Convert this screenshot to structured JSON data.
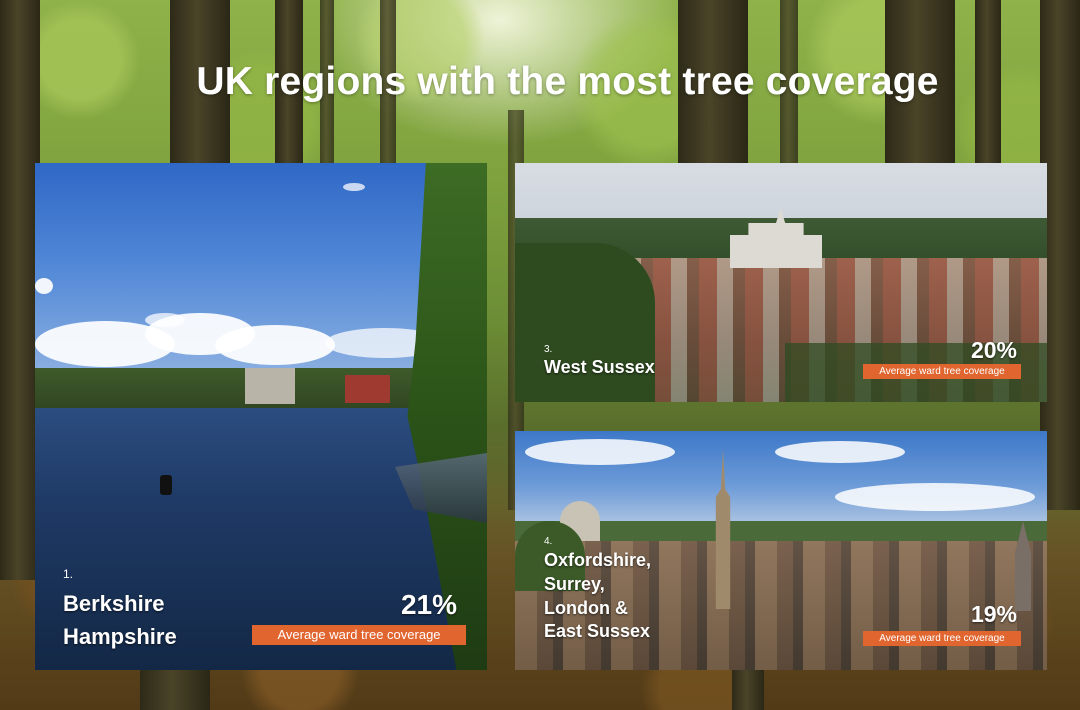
{
  "title": "UK regions with the most tree coverage",
  "regions": [
    {
      "rank": "1.",
      "name_lines": [
        "Berkshire",
        "Hampshire"
      ],
      "percent": "21%",
      "caption": "Average ward tree coverage"
    },
    {
      "rank": "3.",
      "name_lines": [
        "West Sussex"
      ],
      "percent": "20%",
      "caption": "Average ward tree coverage"
    },
    {
      "rank": "4.",
      "name_lines": [
        "Oxfordshire,",
        "Surrey,",
        "London &",
        "East Sussex"
      ],
      "percent": "19%",
      "caption": "Average ward tree coverage"
    }
  ],
  "colors": {
    "caption_bg": "#e0652f",
    "title_text": "#ffffff"
  },
  "images": [
    "river-with-rower-photo",
    "town-with-cathedral-photo",
    "oxford-spires-photo",
    "forest-background-photo"
  ]
}
